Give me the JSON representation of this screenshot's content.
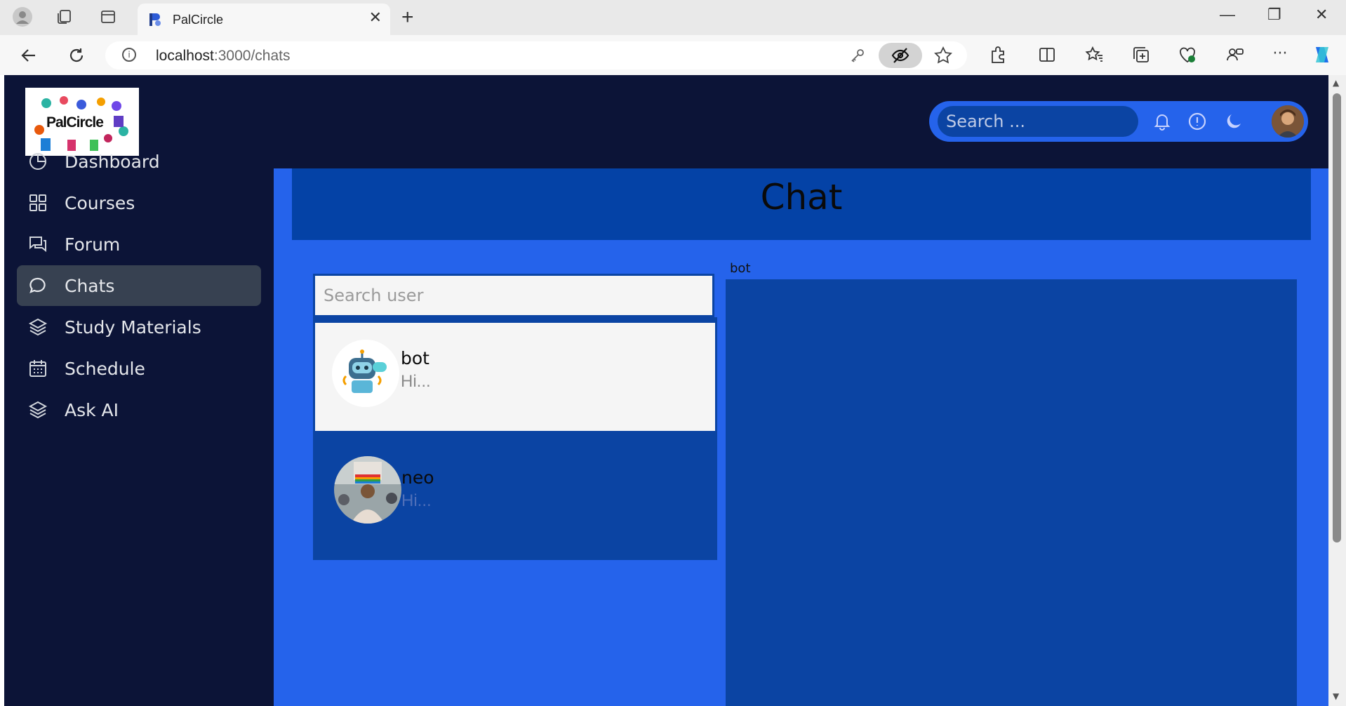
{
  "browser": {
    "tab_title": "PalCircle",
    "url_host": "localhost",
    "url_path": ":3000/chats"
  },
  "app": {
    "logo_text": "PalCircle",
    "header_search_placeholder": "Search ...",
    "page_title": "Chat"
  },
  "sidebar": {
    "items": [
      {
        "label": "Dashboard",
        "icon": "pie-chart-icon"
      },
      {
        "label": "Courses",
        "icon": "grid-icon"
      },
      {
        "label": "Forum",
        "icon": "messages-icon"
      },
      {
        "label": "Chats",
        "icon": "chat-bubble-icon",
        "active": true
      },
      {
        "label": "Study Materials",
        "icon": "layers-icon"
      },
      {
        "label": "Schedule",
        "icon": "calendar-icon"
      },
      {
        "label": "Ask AI",
        "icon": "layers-icon"
      }
    ]
  },
  "chat": {
    "search_placeholder": "Search user",
    "conversations": [
      {
        "name": "bot",
        "preview": "Hi...",
        "selected": true
      },
      {
        "name": "neo",
        "preview": "Hi...",
        "selected": false
      }
    ],
    "active_conversation_label": "bot"
  },
  "colors": {
    "sidebar_bg": "#0c1437",
    "main_bg": "#2563eb",
    "panel_bg": "#0b44a3",
    "active_item_bg": "#374151"
  }
}
